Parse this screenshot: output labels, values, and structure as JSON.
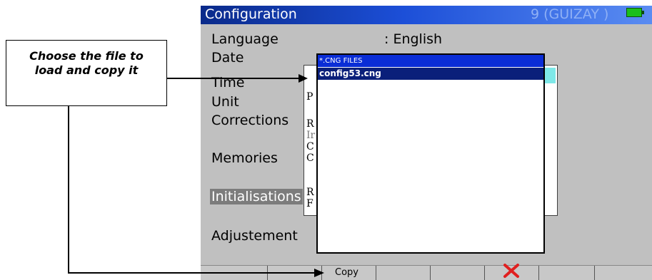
{
  "window": {
    "title": "Configuration",
    "status_right": "9 (GUIZAY     )"
  },
  "menu": {
    "items": [
      {
        "label": "Language",
        "value": ": English"
      },
      {
        "label": "Date",
        "value": ""
      },
      {
        "label": "Time",
        "value": ""
      },
      {
        "label": "Unit",
        "value": ""
      },
      {
        "label": "Corrections",
        "value": ""
      },
      {
        "label": "Memories",
        "value": ""
      },
      {
        "label": "Initialisations",
        "value": ""
      },
      {
        "label": "Adjustement",
        "value": ""
      }
    ],
    "selected": "Initialisations"
  },
  "submenu_partial_letters": [
    "P",
    "R",
    "Ir",
    "C",
    "C",
    "R",
    "F"
  ],
  "file_dialog": {
    "title": "*.CNG FILES",
    "files": [
      "config53.cng"
    ],
    "selected_file": "config53.cng"
  },
  "softkeys": {
    "copy_label": "Copy",
    "cancel_icon": "red-x-icon"
  },
  "callout": {
    "line1": "Choose the file to",
    "line2": "load and copy it"
  },
  "colors": {
    "titlebar_start": "#0a2a8a",
    "titlebar_end": "#5a8cf2",
    "dialog_title_bg": "#0a2dd6",
    "selected_file_bg": "#0a1f7a",
    "menu_highlight": "#7c7c7c",
    "screen_bg": "#c0c0c0",
    "cancel_icon": "#e02020",
    "battery": "#1bbf1b"
  }
}
